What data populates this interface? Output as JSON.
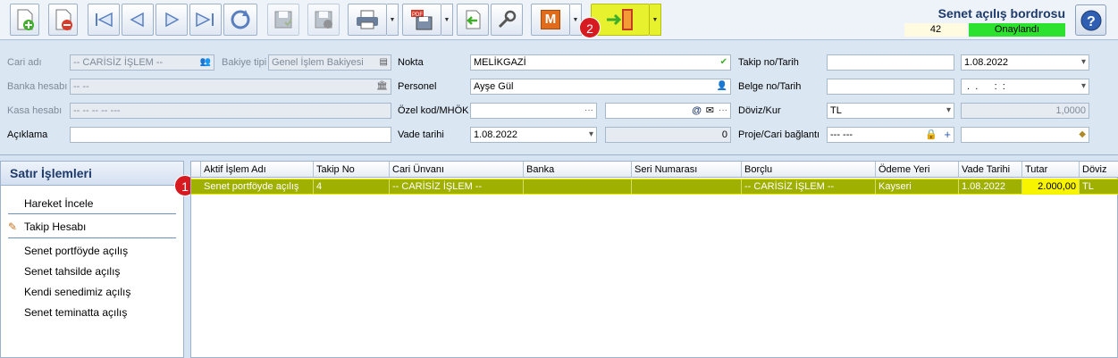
{
  "header": {
    "title": "Senet açılış bordrosu",
    "doc_number": "42",
    "status": "Onaylandı",
    "status_color": "#2ce22e",
    "accent_color": "#1d3a6b"
  },
  "toolbar": {
    "icons": [
      "add-icon",
      "delete-icon",
      "first-icon",
      "previous-icon",
      "next-icon",
      "last-icon",
      "refresh-icon",
      "save-icon",
      "cancel-save-icon",
      "print-icon",
      "pdf-icon",
      "import-icon",
      "tools-icon",
      "m-icon",
      "exit-icon",
      "help-icon"
    ],
    "m_label": "M",
    "highlight_color": "#e7f12d"
  },
  "callouts": {
    "one": "1",
    "two": "2"
  },
  "form": {
    "cari_adi": {
      "label": "Cari adı",
      "value": "-- CARİSİZ İŞLEM --"
    },
    "bakiye_tipi": {
      "label": "Bakiye tipi",
      "value": "Genel İşlem Bakiyesi"
    },
    "banka_hesabi": {
      "label": "Banka hesabı",
      "value": "-- --"
    },
    "kasa_hesabi": {
      "label": "Kasa hesabı",
      "value": "-- -- -- -- ---"
    },
    "aciklama": {
      "label": "Açıklama",
      "value": ""
    },
    "nokta": {
      "label": "Nokta",
      "value": "MELİKGAZİ"
    },
    "personel": {
      "label": "Personel",
      "value": "Ayşe Gül"
    },
    "ozel_kod": {
      "label": "Özel kod/MHÖK",
      "value": "",
      "value2": "",
      "at": "@"
    },
    "vade_tarihi": {
      "label": "Vade tarihi",
      "value": "1.08.2022",
      "days": "0"
    },
    "takip_no": {
      "label": "Takip no/Tarih",
      "value": "",
      "date": "1.08.2022"
    },
    "belge_no": {
      "label": "Belge no/Tarih",
      "value": "",
      "date": " .  .      :  :"
    },
    "doviz_kur": {
      "label": "Döviz/Kur",
      "value": "TL",
      "rate": "1,0000"
    },
    "proje_cari": {
      "label": "Proje/Cari bağlantı",
      "value": "--- ---",
      "value2": ""
    }
  },
  "side_panel": {
    "title": "Satır İşlemleri",
    "items": [
      "Hareket İncele",
      "Takip Hesabı",
      "Senet portföyde açılış",
      "Senet tahsilde açılış",
      "Kendi senedimiz açılış",
      "Senet teminatta açılış"
    ]
  },
  "grid": {
    "columns": [
      "Aktif İşlem Adı",
      "Takip No",
      "Cari Ünvanı",
      "Banka",
      "Seri Numarası",
      "Borçlu",
      "Ödeme Yeri",
      "Vade Tarihi",
      "Tutar",
      "Döviz"
    ],
    "rows": [
      [
        "Senet portföyde açılış",
        "4",
        "-- CARİSİZ İŞLEM --",
        "",
        "",
        "-- CARİSİZ İŞLEM --",
        "Kayseri",
        "1.08.2022",
        "2.000,00",
        "TL"
      ]
    ],
    "selected_row_color": "#a0b000"
  }
}
